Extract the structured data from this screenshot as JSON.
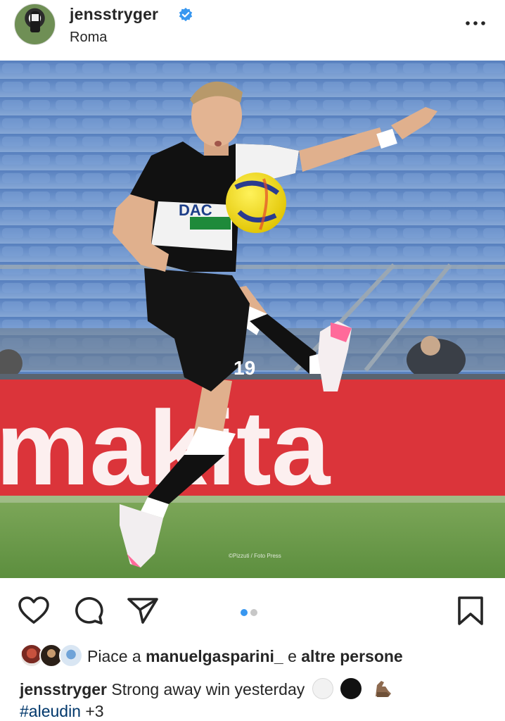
{
  "post": {
    "username": "jensstryger",
    "location": "Roma",
    "verified": true,
    "photo_overlay_text": "makita",
    "photo_watermark": "©Pizzuti / Foto Press",
    "carousel": {
      "count": 2,
      "active_index": 0
    }
  },
  "likes": {
    "prefix": "Piace a ",
    "user": "manuelgasparini_",
    "middle": " e ",
    "others": "altre persone"
  },
  "caption": {
    "user": "jensstryger",
    "text": " Strong away win yesterday",
    "hashtag": "#aleudin",
    "more": " +3"
  },
  "colors": {
    "text": "#262626",
    "verified": "#3897f0",
    "dot_active": "#3897f0",
    "dot_inactive": "#c7c7c7",
    "hashtag": "#00376b",
    "banner_red": "#d8232a"
  },
  "icons": {
    "verified": "verified-badge-icon",
    "more": "more-options-icon",
    "like": "heart-icon",
    "comment": "comment-icon",
    "share": "send-icon",
    "save": "bookmark-icon"
  }
}
